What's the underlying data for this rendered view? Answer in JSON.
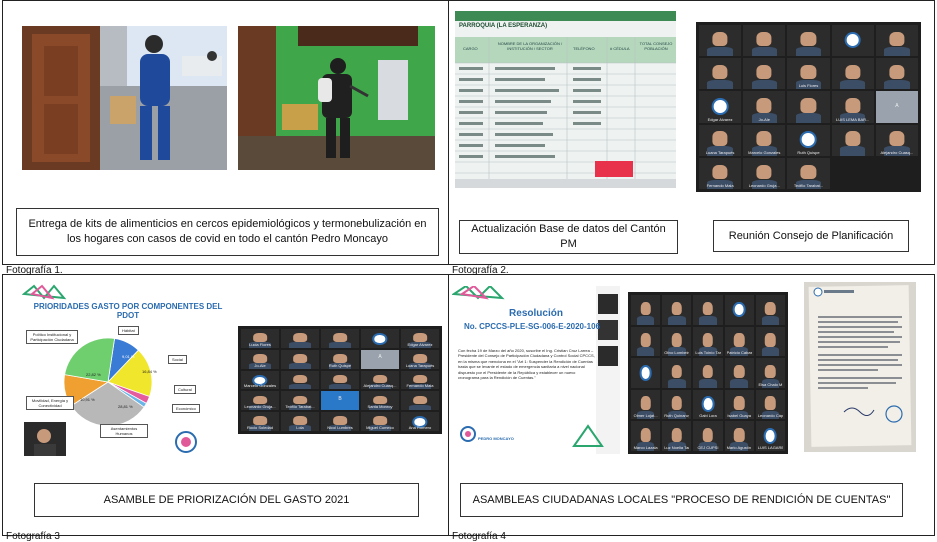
{
  "cells": [
    {
      "caption": "Entrega de kits de  alimenticios en cercos epidemiológicos y termonebulización en los hogares con casos de covid en todo el cantón Pedro Moncayo",
      "label": "Fotografía 1."
    },
    {
      "caption": "Actualización Base de datos del Cantón PM",
      "caption2": "Reunión Consejo de Planificación",
      "label": "Fotografía 2."
    },
    {
      "caption": "ASAMBLE DE PRIORIZACIÓN DEL GASTO  2021",
      "label": "Fotografía 3"
    },
    {
      "caption": "ASAMBLEAS CIUDADANAS LOCALES \"PROCESO DE RENDICIÓN DE CUENTAS\"",
      "label": "Fotografía 4"
    }
  ],
  "spreadsheet": {
    "title": "PARROQUIA (LA ESPERANZA)",
    "headers": [
      "CARGO",
      "NOMBRE DE LA ORGANIZACIÓN / INSTITUCIÓN / SECTOR",
      "TELÉFONO",
      "# CÉDULA",
      "TOTAL CONSEJO POBLACIÓN"
    ]
  },
  "pie_chart": {
    "title": "PRIORIDADES GASTO POR COMPONENTES DEL PDOT",
    "slices": [
      {
        "label": "Hábitat",
        "value": "9,01 %",
        "color": "#3a7bd5"
      },
      {
        "label": "Social",
        "value": "16,84 %",
        "color": "#f0e62c"
      },
      {
        "label": "Cultural",
        "value": "",
        "color": "#e45b9e"
      },
      {
        "label": "Económico",
        "value": "",
        "color": "#6bb6e8"
      },
      {
        "label": "Asentamientos Humanos",
        "value": "28,81 %",
        "color": "#b8b8b8"
      },
      {
        "label": "Movilidad, Energía y Conectividad",
        "value": "10,91 %",
        "color": "#f0a030"
      },
      {
        "label": "Político Institucional y Participación Ciudadana",
        "value": "22,82 %",
        "color": "#6fcf6f"
      }
    ]
  },
  "resolution": {
    "title": "Resolución",
    "number": "No. CPCCS-PLE-SG-006-E-2020-106",
    "body": "Con fecha 19 de Marzo del año 2020, suscribe el Ing. Cristian Cruz Larrea – Presidente del Consejo de Participación Ciudadana y Control Social CPCCS, en la misma que menciona en el \"Art 1: Suspender la Rendición de Cuentas hasta que se levante el estado de emergencia sanitaria a nivel nacional dispuesto por el Presidente de la República y establecer un nuevo cronograma para la Rendición de Cuentas.\"",
    "logo_text": "PEDRO MONCAYO"
  },
  "meeting1": [
    "",
    "",
    "",
    "",
    "",
    "",
    "",
    "Luis Flores",
    "",
    "",
    "Edgar Alvarez",
    "Jo-Ale",
    "",
    "LUIS LEMA BAR...",
    "A",
    "Luana Tarapués",
    "Marcelo Gonzales",
    "Ruth Quispe",
    "",
    "Alejandro Cuasq...",
    "Fernando Mala",
    "Leonardo Gruja...",
    "Teófilo Tarabat..."
  ],
  "meeting2": [
    "Lucia Flores",
    "",
    "",
    "",
    "Edgar Alvarez",
    "Jo-Ale",
    "",
    "Ruth Quispe",
    "A",
    "Luana Tarapués",
    "Marcelo Gonzales",
    "",
    "",
    "Alejandro Cuasq...",
    "Fernando Mala",
    "Leonardo Gruja...",
    "Teófilo Tarabat...",
    "B",
    "Santa Monroy",
    "",
    "Rocio Soledad",
    "Lola",
    "Nicol Lumbres",
    "Miguel Cumeco",
    "Ana Romero"
  ],
  "meeting3": [
    "",
    "",
    "",
    "",
    "",
    "",
    "Olivo Lombeira",
    "Luis Toinío Tar...",
    "Patricio Cabasa...",
    "",
    "",
    "",
    "",
    "",
    "Elsa Chalo M",
    "Olmer Lojat...",
    "Ruth Quinancy...",
    "Gabi Lora",
    "Isabel Guaya",
    "Leonardo Cáp...",
    "Marco Lazala",
    "Luz Noelia Tarz...",
    "CEJ CUPSI",
    "Mario Agustín H...",
    "LUIS LAGARES"
  ]
}
